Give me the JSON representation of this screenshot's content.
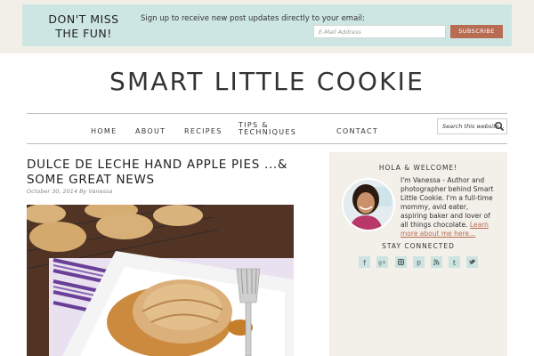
{
  "signup": {
    "headline": "DON'T MISS THE FUN!",
    "text": "Sign up to receive new post updates directly to your email:",
    "email_placeholder": "E-Mail Address",
    "button": "SUBSCRIBE"
  },
  "site": {
    "title": "SMART LITTLE COOKIE"
  },
  "nav": {
    "home": "HOME",
    "about": "ABOUT",
    "recipes": "RECIPES",
    "tips_line1": "TIPS &",
    "tips_line2": "TECHNIQUES",
    "contact": "CONTACT",
    "search_placeholder": "Search this website..."
  },
  "post": {
    "title": "DULCE DE LECHE HAND APPLE PIES ...& SOME GREAT NEWS",
    "meta": "October 30, 2014 By Vanessa"
  },
  "sidebar": {
    "greeting": "HOLA & WELCOME!",
    "bio": "I'm Vanessa - Author and photographer behind Smart Little Cookie. I'm a full-time mommy, avid eater, aspiring baker and lover of all things chocolate.",
    "learn_more": "Learn more about me here...",
    "stay_connected": "STAY CONNECTED",
    "social_icons": [
      "facebook-icon",
      "google-plus-icon",
      "instagram-icon",
      "pinterest-icon",
      "rss-icon",
      "tumblr-icon",
      "twitter-icon"
    ]
  },
  "colors": {
    "signup_bg": "#cde6e3",
    "button": "#b86c52",
    "sidebar_bg": "#f3efe9",
    "social_bg": "#cbe4e1",
    "link": "#b86c52"
  }
}
